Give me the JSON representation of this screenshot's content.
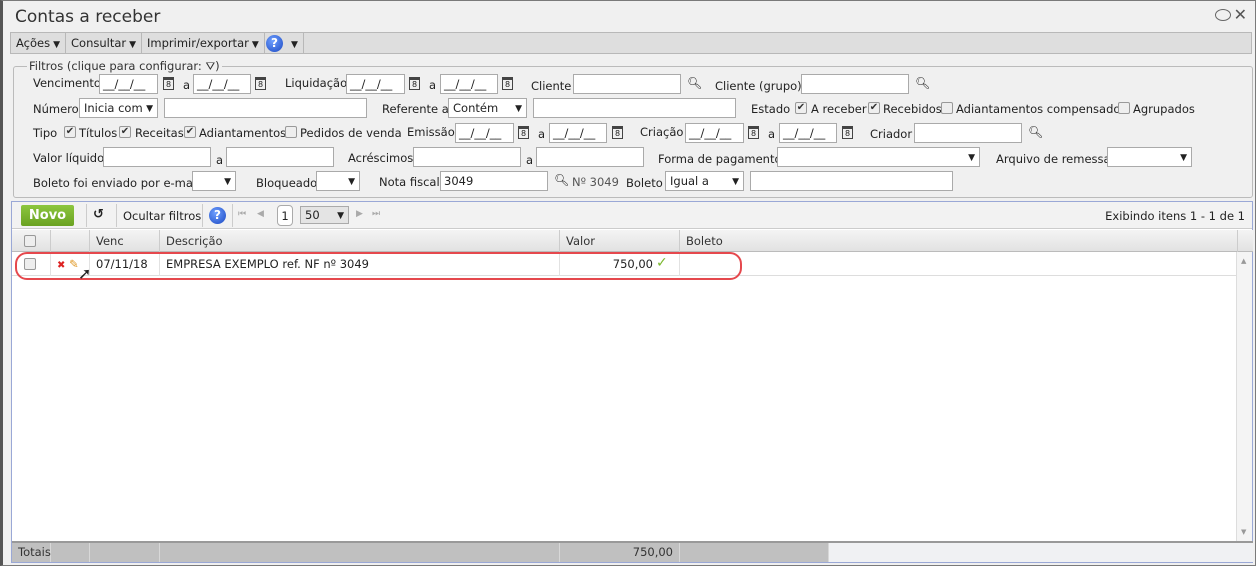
{
  "window": {
    "title": "Contas a receber"
  },
  "menu": [
    {
      "label": "Ações"
    },
    {
      "label": "Consultar"
    },
    {
      "label": "Imprimir/exportar"
    }
  ],
  "filters": {
    "legend": "Filtros (clique para configurar:",
    "legend_end": ")",
    "vencimento": "Vencimento",
    "liquidacao": "Liquidação",
    "a": "a",
    "date_mask": "__/__/__",
    "cliente": "Cliente",
    "cliente_grupo": "Cliente (grupo)",
    "numero": "Número",
    "numero_op": "Inicia com",
    "referente": "Referente a",
    "referente_op": "Contém",
    "estado": "Estado",
    "estado_opts": [
      {
        "label": "A receber",
        "checked": true
      },
      {
        "label": "Recebidos",
        "checked": true
      },
      {
        "label": "Adiantamentos compensados",
        "checked": false
      },
      {
        "label": "Agrupados",
        "checked": false
      }
    ],
    "tipo": "Tipo",
    "tipo_opts": [
      {
        "label": "Títulos",
        "checked": true
      },
      {
        "label": "Receitas",
        "checked": true
      },
      {
        "label": "Adiantamentos",
        "checked": true
      },
      {
        "label": "Pedidos de venda",
        "checked": false
      }
    ],
    "emissao": "Emissão",
    "criacao": "Criação",
    "criador": "Criador",
    "valor_liquido": "Valor líquido",
    "acrescimos": "Acréscimos",
    "forma_pagamento": "Forma de pagamento",
    "arquivo_remessa": "Arquivo de remessa",
    "boleto_email": "Boleto foi enviado por e-mail",
    "bloqueado": "Bloqueado",
    "nota_fiscal": "Nota fiscal",
    "nota_fiscal_value": "3049",
    "nota_fiscal_info": "Nº 3049",
    "boleto": "Boleto",
    "boleto_op": "Igual a"
  },
  "grid": {
    "new_label": "Novo",
    "hide_filters": "Ocultar filtros",
    "page": "1",
    "page_size": "50",
    "status": "Exibindo itens 1 - 1 de 1",
    "columns": [
      "Venc",
      "Descrição",
      "Valor",
      "Boleto"
    ],
    "rows": [
      {
        "venc": "07/11/18",
        "descricao": "EMPRESA EXEMPLO ref. NF nº 3049",
        "valor": "750,00",
        "paid": true,
        "boleto": ""
      }
    ],
    "totals_label": "Totais:",
    "totals_valor": "750,00"
  },
  "colors": {
    "accent": "#8cc63f",
    "highlight": "#e5484d"
  }
}
